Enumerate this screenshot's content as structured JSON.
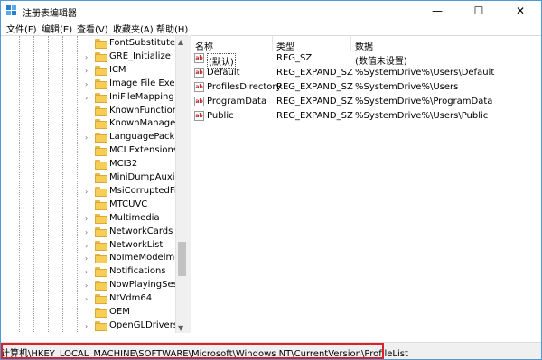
{
  "window": {
    "title": "注册表编辑器",
    "minimize": "—",
    "maximize": "☐",
    "close": "✕"
  },
  "menu": [
    "文件(F)",
    "编辑(E)",
    "查看(V)",
    "收藏夹(A)",
    "帮助(H)"
  ],
  "tree": {
    "items": [
      {
        "label": "FontSubstitutes",
        "expandable": false
      },
      {
        "label": "GRE_Initialize",
        "expandable": true
      },
      {
        "label": "ICM",
        "expandable": true
      },
      {
        "label": "Image File Executi",
        "expandable": true
      },
      {
        "label": "IniFileMapping",
        "expandable": true
      },
      {
        "label": "KnownFunctionTa",
        "expandable": false
      },
      {
        "label": "KnownManagedDe",
        "expandable": false
      },
      {
        "label": "LanguagePack",
        "expandable": true
      },
      {
        "label": "MCI Extensions",
        "expandable": false
      },
      {
        "label": "MCI32",
        "expandable": false
      },
      {
        "label": "MiniDumpAuxiliar",
        "expandable": false
      },
      {
        "label": "MsiCorruptedFile",
        "expandable": true
      },
      {
        "label": "MTCUVC",
        "expandable": false
      },
      {
        "label": "Multimedia",
        "expandable": true
      },
      {
        "label": "NetworkCards",
        "expandable": true
      },
      {
        "label": "NetworkList",
        "expandable": true
      },
      {
        "label": "NoImeModelmes",
        "expandable": true
      },
      {
        "label": "Notifications",
        "expandable": true
      },
      {
        "label": "NowPlayingSessi",
        "expandable": true
      },
      {
        "label": "NtVdm64",
        "expandable": true
      },
      {
        "label": "OEM",
        "expandable": false
      },
      {
        "label": "OpenGLDrivers",
        "expandable": true
      }
    ]
  },
  "list": {
    "headers": {
      "name": "名称",
      "type": "类型",
      "data": "数据"
    },
    "rows": [
      {
        "name": "(默认)",
        "type": "REG_SZ",
        "data": "(数值未设置)"
      },
      {
        "name": "Default",
        "type": "REG_EXPAND_SZ",
        "data": "%SystemDrive%\\Users\\Default"
      },
      {
        "name": "ProfilesDirectory",
        "type": "REG_EXPAND_SZ",
        "data": "%SystemDrive%\\Users"
      },
      {
        "name": "ProgramData",
        "type": "REG_EXPAND_SZ",
        "data": "%SystemDrive%\\ProgramData"
      },
      {
        "name": "Public",
        "type": "REG_EXPAND_SZ",
        "data": "%SystemDrive%\\Users\\Public"
      }
    ],
    "value_icon_text": "ab"
  },
  "status": {
    "path": "计算机\\HKEY_LOCAL_MACHINE\\SOFTWARE\\Microsoft\\Windows NT\\CurrentVersion\\ProfileList"
  },
  "colors": {
    "highlight": "#e21f26",
    "folder": "#f6cd55",
    "title_border": "#4a9bd8"
  }
}
